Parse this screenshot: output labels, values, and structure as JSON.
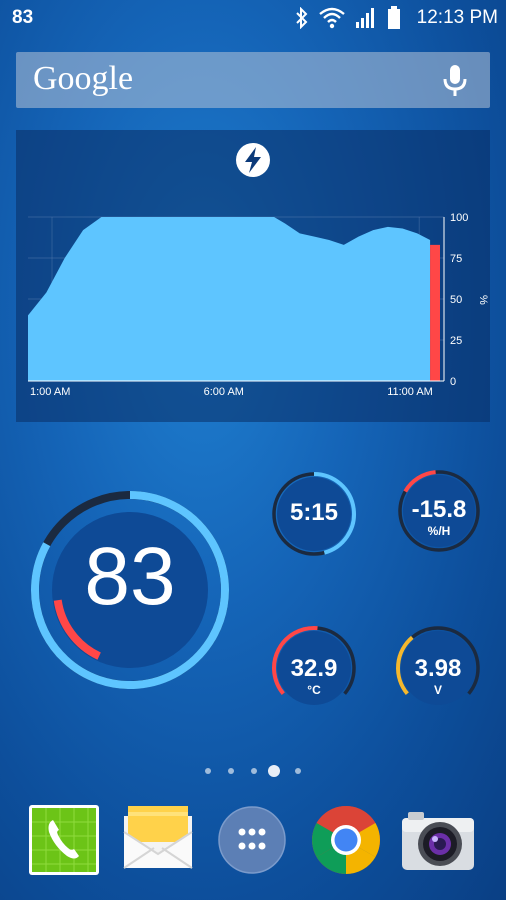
{
  "status_bar": {
    "battery_label": "83",
    "time": "12:13 PM",
    "icons": [
      "bluetooth-icon",
      "wifi-icon",
      "signal-icon",
      "battery-icon"
    ]
  },
  "search": {
    "logo_text": "Google",
    "icon": "mic-icon"
  },
  "battery_chart": {
    "icon": "lightning-bolt-icon",
    "colors": {
      "fill": "#5ec5ff",
      "discharge": "#ff4747",
      "grid": "#5b7fb0"
    }
  },
  "chart_data": {
    "type": "area",
    "x_tick_labels": [
      "1:00 AM",
      "6:00 AM",
      "11:00 AM"
    ],
    "y_tick_labels": [
      "100",
      "75",
      "50",
      "25",
      "0"
    ],
    "y_unit": "%",
    "ylim": [
      0,
      100
    ],
    "grid": true,
    "series": [
      {
        "points_hour_value": [
          [
            1.0,
            40
          ],
          [
            1.5,
            54
          ],
          [
            2.0,
            75
          ],
          [
            2.5,
            92
          ],
          [
            3.0,
            100
          ],
          [
            7.7,
            100
          ],
          [
            8.0,
            96
          ],
          [
            8.4,
            90
          ],
          [
            8.8,
            88
          ],
          [
            9.2,
            86
          ],
          [
            9.6,
            83
          ],
          [
            10.0,
            88
          ],
          [
            10.4,
            92
          ],
          [
            10.8,
            94
          ],
          [
            11.2,
            93
          ],
          [
            11.6,
            90
          ],
          [
            11.95,
            86
          ]
        ]
      },
      {
        "points_hour_value": [
          [
            11.95,
            83
          ],
          [
            12.22,
            83
          ],
          [
            12.22,
            68
          ]
        ]
      }
    ]
  },
  "gauges": {
    "battery": {
      "value": "83",
      "level": 0.83,
      "color": "#5ec5ff",
      "accent": "#ff4747"
    },
    "time_left": {
      "value": "5:15",
      "level": 0.45,
      "color": "#5ec5ff"
    },
    "rate": {
      "value": "-15.8",
      "unit": "%/H",
      "level": 0.18,
      "color": "#ff4747"
    },
    "temperature": {
      "value": "32.9",
      "unit": "°C",
      "level": 0.5,
      "color": "#ff4747"
    },
    "voltage": {
      "value": "3.98",
      "unit": "V",
      "level": 0.4,
      "color": "#f5b82e"
    }
  },
  "page_indicator": {
    "count": 5,
    "active": 3
  },
  "dock": {
    "apps": [
      "phone-icon",
      "email-icon",
      "app-drawer-icon",
      "chrome-icon",
      "camera-icon"
    ]
  }
}
